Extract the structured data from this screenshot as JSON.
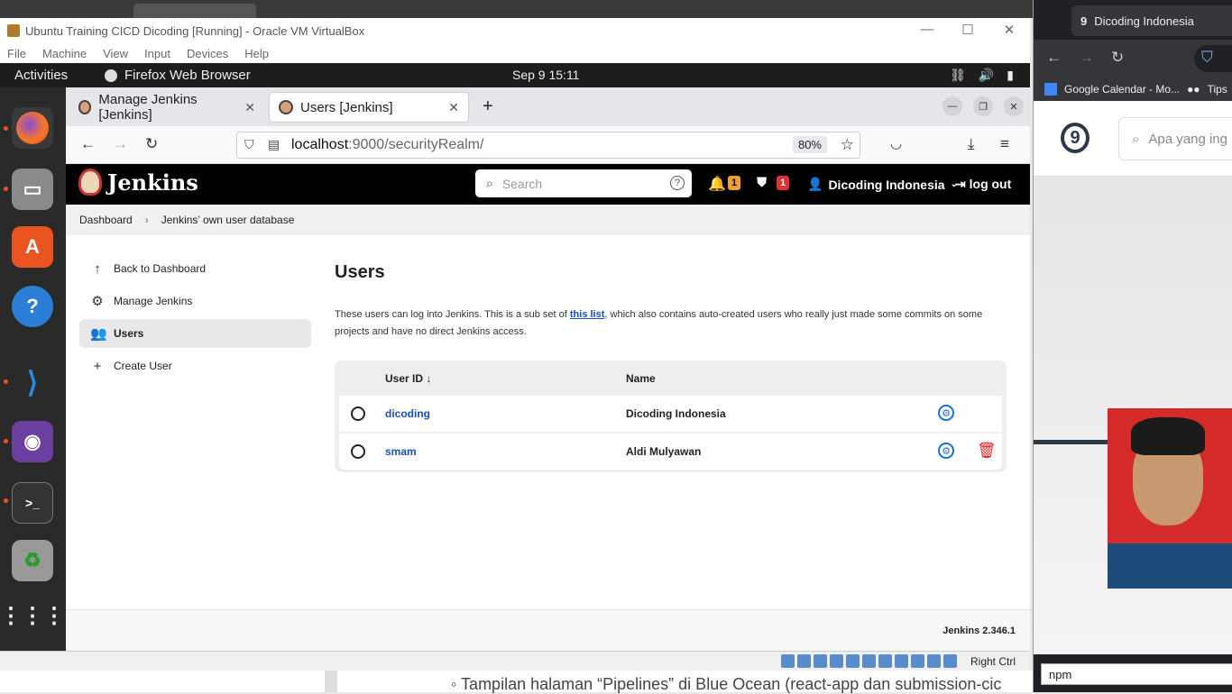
{
  "virtualbox": {
    "title": "Ubuntu Training CICD Dicoding [Running] - Oracle VM VirtualBox",
    "menu": [
      "File",
      "Machine",
      "View",
      "Input",
      "Devices",
      "Help"
    ],
    "host_key": "Right Ctrl"
  },
  "gnome": {
    "activities": "Activities",
    "app_name": "Firefox Web Browser",
    "clock": "Sep 9  15:11"
  },
  "firefox": {
    "tabs": [
      {
        "label": "Manage Jenkins [Jenkins]"
      },
      {
        "label": "Users [Jenkins]"
      }
    ],
    "url_host": "localhost",
    "url_path": ":9000/securityRealm/",
    "zoom": "80%"
  },
  "jenkins": {
    "logo_text": "Jenkins",
    "search_placeholder": "Search",
    "notifications_count": "1",
    "security_count": "1",
    "user_name": "Dicoding Indonesia",
    "logout": "log out",
    "breadcrumb": [
      "Dashboard",
      "Jenkins’ own user database"
    ],
    "sidebar": [
      {
        "label": "Back to Dashboard",
        "icon": "arrow-up-icon"
      },
      {
        "label": "Manage Jenkins",
        "icon": "gear-icon"
      },
      {
        "label": "Users",
        "icon": "users-icon"
      },
      {
        "label": "Create User",
        "icon": "plus-icon"
      }
    ],
    "page_title": "Users",
    "desc_before": "These users can log into Jenkins. This is a sub set of ",
    "desc_link": "this list",
    "desc_after": ", which also contains auto-created users who really just made some commits on some projects and have no direct Jenkins access.",
    "table": {
      "columns": [
        "User ID ↓",
        "Name"
      ],
      "rows": [
        {
          "id": "dicoding",
          "name": "Dicoding Indonesia",
          "deletable": false
        },
        {
          "id": "smam",
          "name": "Aldi Mulyawan",
          "deletable": true
        }
      ]
    },
    "version": "Jenkins 2.346.1"
  },
  "host_doc": {
    "text": "◦  Tampilan halaman “Pipelines” di Blue Ocean (react-app dan submission-cic"
  },
  "right_browser": {
    "tab_title": "Dicoding Indonesia",
    "bookmarks": [
      "Google Calendar - Mo...",
      "Tips"
    ],
    "search_placeholder": "Apa yang ing",
    "find_input": "npm"
  },
  "colors": {
    "jenkins_header": "#000000",
    "link": "#1a4fbf",
    "delete": "#dd2222",
    "badge_warning": "#f0a030",
    "badge_danger": "#e03030"
  }
}
